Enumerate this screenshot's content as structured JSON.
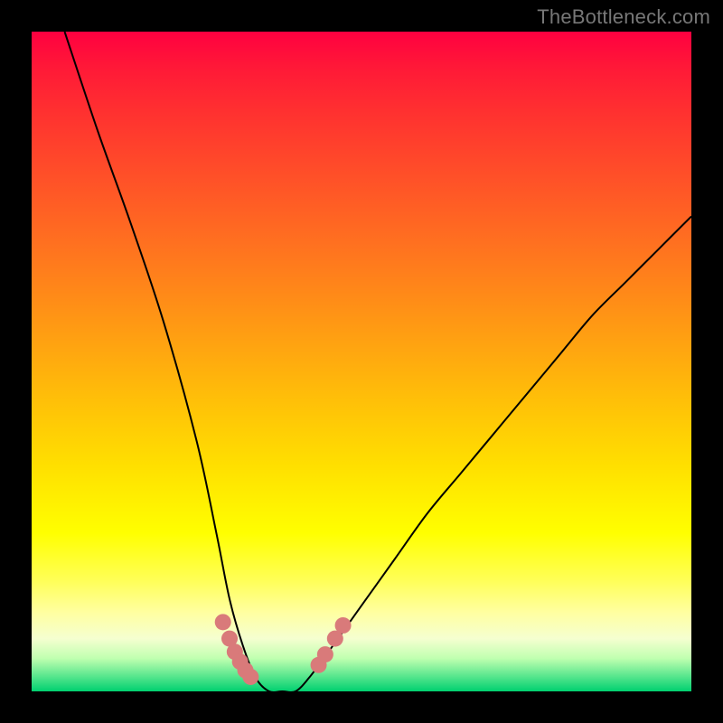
{
  "watermark": "TheBottleneck.com",
  "chart_data": {
    "type": "line",
    "title": "",
    "xlabel": "",
    "ylabel": "",
    "xlim": [
      0,
      100
    ],
    "ylim": [
      0,
      100
    ],
    "series": [
      {
        "name": "bottleneck-curve",
        "x": [
          5,
          10,
          15,
          20,
          25,
          28,
          30,
          32,
          34,
          36,
          38,
          40,
          42,
          45,
          50,
          55,
          60,
          65,
          70,
          75,
          80,
          85,
          90,
          95,
          100
        ],
        "values": [
          100,
          85,
          71,
          56,
          38,
          24,
          14,
          7,
          2,
          0,
          0,
          0,
          2,
          6,
          13,
          20,
          27,
          33,
          39,
          45,
          51,
          57,
          62,
          67,
          72
        ]
      }
    ],
    "markers": [
      {
        "name": "left-cluster",
        "x": [
          29,
          30,
          30.8,
          31.6,
          32.4,
          33.2
        ],
        "y": [
          10.5,
          8,
          6,
          4.5,
          3.2,
          2.2
        ]
      },
      {
        "name": "right-cluster",
        "x": [
          43.5,
          44.5,
          46,
          47.2
        ],
        "y": [
          4,
          5.6,
          8,
          10
        ]
      }
    ],
    "gradient_stops": [
      {
        "pos": 0,
        "color": "#ff0040"
      },
      {
        "pos": 0.5,
        "color": "#ffc008"
      },
      {
        "pos": 0.92,
        "color": "#f5ffd0"
      },
      {
        "pos": 1.0,
        "color": "#00d070"
      }
    ],
    "marker_color": "#d97a7a",
    "curve_color": "#000000"
  }
}
